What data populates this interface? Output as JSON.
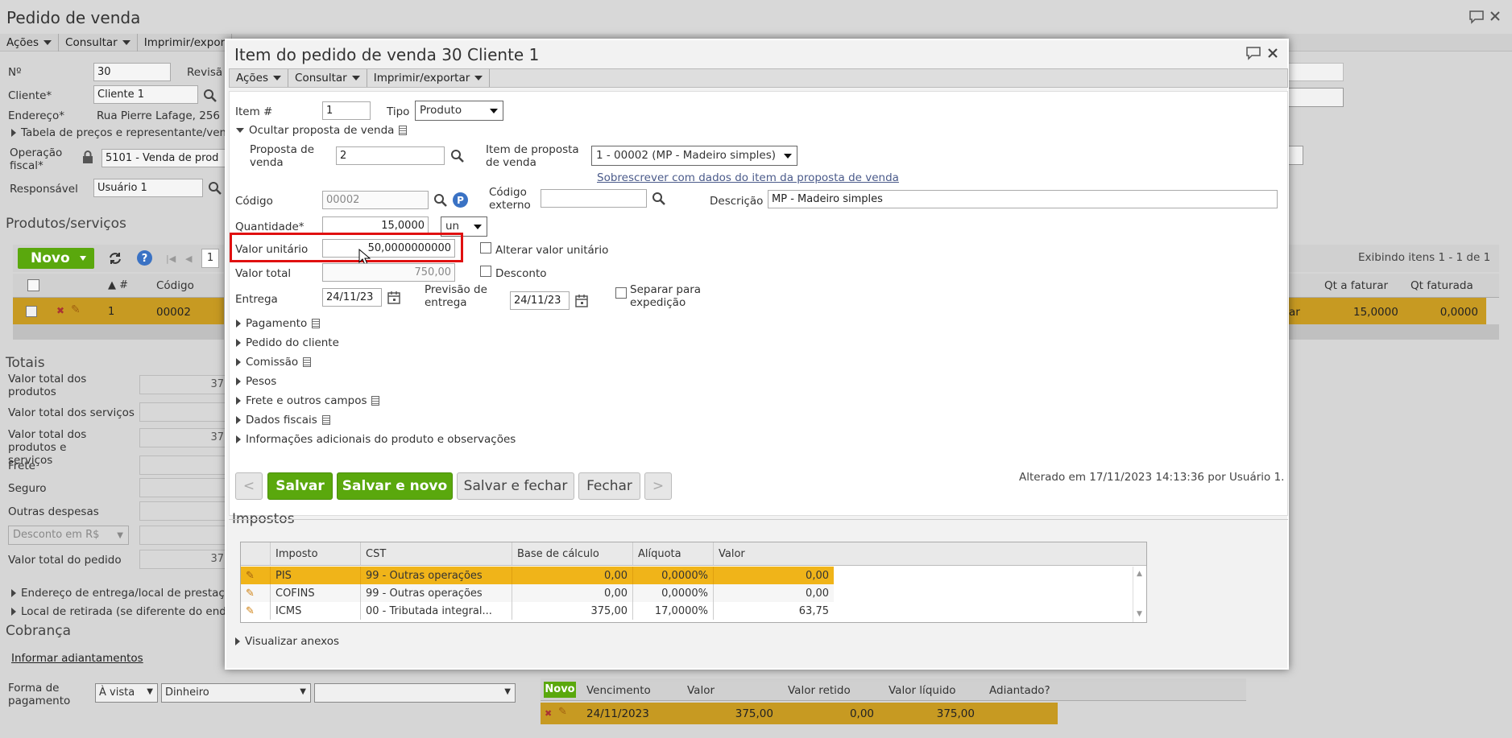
{
  "bg": {
    "title": "Pedido de venda",
    "menu": [
      "Ações",
      "Consultar",
      "Imprimir/expor"
    ],
    "no_label": "Nº",
    "no_value": "30",
    "revisao_label": "Revisã",
    "cliente_label": "Cliente*",
    "cliente_value": "Cliente 1",
    "endereco_label": "Endereço*",
    "endereco_value": "Rua Pierre Lafage, 256",
    "tabela_link": "Tabela de preços e representante/ven",
    "operacao_label": "Operação fiscal*",
    "operacao_value": "5101 - Venda de prod",
    "responsavel_label": "Responsável",
    "responsavel_value": "Usuário 1",
    "produtos_title": "Produtos/serviços",
    "novo_label": "Novo",
    "page_num": "1",
    "exibindo": "Exibindo itens 1 - 1 de 1",
    "grid_hash": "#",
    "grid_codigo": "Código",
    "grid_qt_faturar": "Qt a faturar",
    "grid_qt_faturada": "Qt faturada",
    "row_num": "1",
    "row_codigo": "00002",
    "row_frag": "ar",
    "row_qt_faturar": "15,0000",
    "row_qt_faturada": "0,0000",
    "totais_title": "Totais",
    "t_prod": "Valor total dos produtos",
    "t_serv": "Valor total dos serviços",
    "t_ps": "Valor total dos produtos e serviços",
    "t_frete": "Frete",
    "t_seguro": "Seguro",
    "t_outras": "Outras despesas",
    "t_desconto": "Desconto em R$",
    "t_pedido": "Valor total do pedido",
    "frag37": "37",
    "end_entrega": "Endereço de entrega/local de prestaç",
    "local_retirada": "Local de retirada (se diferente do end",
    "cobranca_title": "Cobrança",
    "informar_adiant": "Informar adiantamentos",
    "forma_pag_label": "Forma de pagamento",
    "forma_avista": "À vista",
    "forma_dinheiro": "Dinheiro",
    "parc_novo": "Novo",
    "parc_cols": [
      "Vencimento",
      "Valor",
      "Valor retido",
      "Valor líquido",
      "Adiantado?"
    ],
    "parc_row": [
      "24/11/2023",
      "375,00",
      "0,00",
      "375,00",
      ""
    ]
  },
  "modal": {
    "title": "Item do pedido de venda 30 Cliente 1",
    "menu": [
      "Ações",
      "Consultar",
      "Imprimir/exportar"
    ],
    "item_label": "Item #",
    "item_value": "1",
    "tipo_label": "Tipo",
    "tipo_value": "Produto",
    "ocultar_proposta": "Ocultar proposta de venda",
    "proposta_label": "Proposta de venda",
    "proposta_value": "2",
    "item_proposta_label": "Item de proposta de venda",
    "item_proposta_value": "1 - 00002 (MP - Madeiro simples)",
    "sobrescrever_link": "Sobrescrever com dados do item da proposta de venda",
    "codigo_label": "Código",
    "codigo_value": "00002",
    "codigo_externo_label": "Código externo",
    "descricao_label": "Descrição",
    "descricao_value": "MP - Madeiro simples",
    "quantidade_label": "Quantidade*",
    "quantidade_value": "15,0000",
    "unidade_value": "un",
    "valor_unitario_label": "Valor unitário",
    "valor_unitario_value": "50,0000000000",
    "alterar_valor_label": "Alterar valor unitário",
    "valor_total_label": "Valor total",
    "valor_total_value": "750,00",
    "desconto_label": "Desconto",
    "entrega_label": "Entrega",
    "entrega_value": "24/11/23",
    "previsao_label": "Previsão de entrega",
    "previsao_value": "24/11/23",
    "separar_label": "Separar para expedição",
    "sections": [
      "Pagamento",
      "Pedido do cliente",
      "Comissão",
      "Pesos",
      "Frete e outros campos",
      "Dados fiscais",
      "Informações adicionais do produto e observações"
    ],
    "btn_prev": "<",
    "btn_salvar": "Salvar",
    "btn_salvar_novo": "Salvar e novo",
    "btn_salvar_fechar": "Salvar e fechar",
    "btn_fechar": "Fechar",
    "btn_next": ">",
    "alterado": "Alterado em 17/11/2023 14:13:36 por Usuário 1.",
    "impostos_title": "Impostos",
    "impostos_cols": [
      "Imposto",
      "CST",
      "Base de cálculo",
      "Alíquota",
      "Valor"
    ],
    "impostos_rows": [
      [
        "PIS",
        "99 - Outras operações",
        "0,00",
        "0,0000%",
        "0,00"
      ],
      [
        "COFINS",
        "99 - Outras operações",
        "0,00",
        "0,0000%",
        "0,00"
      ],
      [
        "ICMS",
        "00 - Tributada integral...",
        "375,00",
        "17,0000%",
        "63,75"
      ]
    ],
    "visualizar_anexos": "Visualizar anexos"
  },
  "colors": {
    "accent_green": "#5aa80d",
    "row_highlight": "#f0b419",
    "highlight_box": "#e01010",
    "link": "#4a5a8a"
  }
}
